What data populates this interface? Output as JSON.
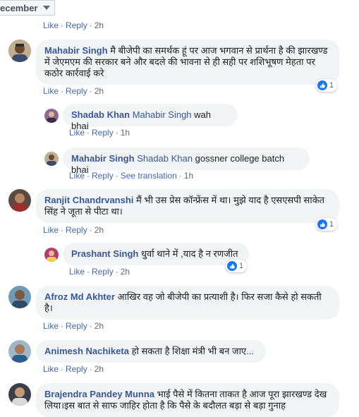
{
  "filter": {
    "label": "ecember"
  },
  "actions": {
    "like": "Like",
    "reply": "Reply",
    "see_translation": "See translation",
    "sep": "·"
  },
  "top_partial": {
    "time": "2h"
  },
  "comments": [
    {
      "author": "Mahabir Singh",
      "text": "मै बीजेपी का समर्थक हूं पर आज भगवान से प्रार्थना है की झारखण्ड में जेएमएम की सरकार बने और बदले की भावना से ही सही पर शशिभूषण मेहता पर कठोर कार्रवाई करे",
      "time": "2h",
      "reactions": "1",
      "replies": [
        {
          "author": "Shadab Khan",
          "mention": "Mahabir Singh",
          "text": "wah bhai",
          "time": "1h"
        },
        {
          "author": "Mahabir Singh",
          "mention": "Shadab Khan",
          "text": "gossner college batch bhai",
          "time": "1h"
        }
      ]
    },
    {
      "author": "Ranjit Chandrvanshi",
      "text": "मैं भी उस प्रेस कॉन्फ्रेंस में था। मुझे याद है एसएसपी साकेत सिंह ने जूता से पीटा था।",
      "time": "2h",
      "reactions": "1",
      "replies": [
        {
          "author": "Prashant Singh",
          "text": "धुर्वा थाने में ,याद है न रणजीत",
          "time": "2h",
          "reactions": "1"
        }
      ]
    },
    {
      "author": "Afroz Md Akhter",
      "text": "आखिर वह जो बीजेपी का प्रत्याशी है। फिर सजा कैसे हो सकती है।",
      "time": "2h"
    },
    {
      "author": "Animesh Nachiketa",
      "text": "हो सकता है शिक्षा मंत्री भी बन जाए...",
      "time": "2h"
    },
    {
      "author": "Brajendra Pandey Munna",
      "text": "भाई पैसे में कितना ताकत है आज पूरा झारखण्ड देख लिया।इस बात से साफ जाहिर होता है कि पैसे के बदौलत बड़ा से बड़ा गुनाह"
    }
  ]
}
